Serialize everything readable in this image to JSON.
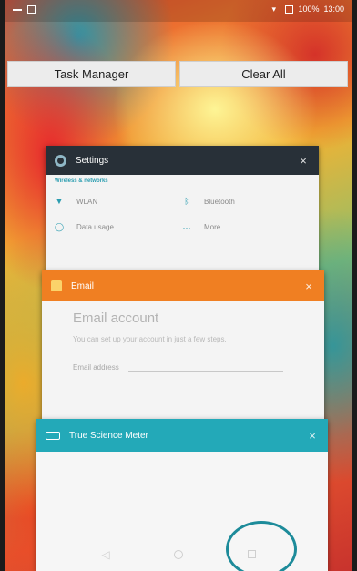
{
  "status_bar": {
    "time": "13:00",
    "battery": "100%"
  },
  "buttons": {
    "task_manager": "Task Manager",
    "clear_all": "Clear All"
  },
  "cards": {
    "settings": {
      "title": "Settings",
      "close": "×",
      "section": "Wireless & networks",
      "items": [
        {
          "label": "WLAN",
          "icon": "wifi-icon"
        },
        {
          "label": "Bluetooth",
          "icon": "bluetooth-icon"
        },
        {
          "label": "Data usage",
          "icon": "data-usage-icon"
        },
        {
          "label": "More",
          "icon": "more-icon"
        }
      ]
    },
    "email": {
      "title": "Email",
      "close": "×",
      "heading": "Email account",
      "subtitle": "You can set up your account in just a few steps.",
      "field_label": "Email address"
    },
    "tsm": {
      "title": "True Science Meter",
      "close": "×"
    }
  },
  "nav": {
    "back": "◁"
  },
  "colors": {
    "settings_header": "#283038",
    "email_header": "#f07f22",
    "tsm_header": "#23a9b8",
    "highlight": "#1d8b9a"
  }
}
